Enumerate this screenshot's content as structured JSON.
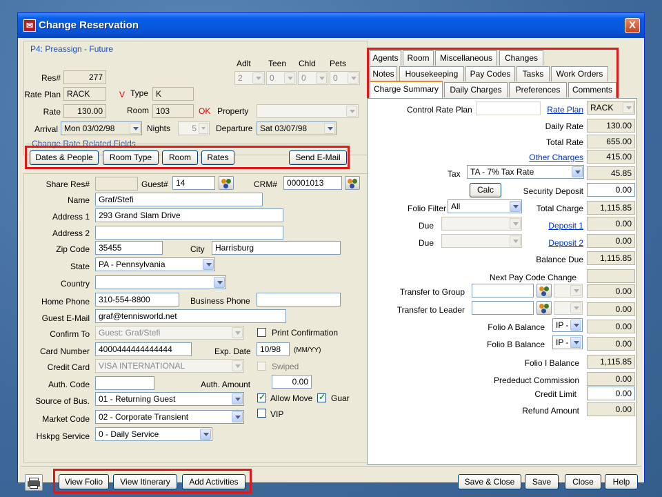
{
  "window": {
    "title": "Change Reservation",
    "close_label": "X"
  },
  "status": {
    "text": "P4: Preassign - Future"
  },
  "res": {
    "res_label": "Res#",
    "res_value": "277",
    "rate_plan_label": "Rate Plan",
    "rate_plan_value": "RACK",
    "v_marker": "V",
    "type_label": "Type",
    "type_value": "K",
    "rate_label": "Rate",
    "rate_value": "130.00",
    "room_label": "Room",
    "room_value": "103",
    "ok_marker": "OK",
    "property_label": "Property",
    "property_value": "",
    "arrival_label": "Arrival",
    "arrival_value": "Mon 03/02/98",
    "nights_label": "Nights",
    "nights_value": "5",
    "departure_label": "Departure",
    "departure_value": "Sat 03/07/98",
    "adlt_label": "Adlt",
    "teen_label": "Teen",
    "chld_label": "Chld",
    "pets_label": "Pets",
    "adlt_value": "2",
    "teen_value": "0",
    "chld_value": "0",
    "pets_value": "0",
    "group_caption": "Change Rate Related Fields"
  },
  "rate_buttons": {
    "dates_people": "Dates & People",
    "room_type": "Room Type",
    "room": "Room",
    "rates": "Rates",
    "send_email": "Send E-Mail"
  },
  "guest": {
    "share_res_label": "Share Res#",
    "share_res_value": "",
    "guest_no_label": "Guest#",
    "guest_no_value": "14",
    "crm_label": "CRM#",
    "crm_value": "00001013",
    "name_label": "Name",
    "name_value": "Graf/Stefi",
    "address1_label": "Address 1",
    "address1_value": "293 Grand Slam Drive",
    "address2_label": "Address 2",
    "address2_value": "",
    "zip_label": "Zip Code",
    "zip_value": "35455",
    "city_label": "City",
    "city_value": "Harrisburg",
    "state_label": "State",
    "state_value": "PA - Pennsylvania",
    "country_label": "Country",
    "country_value": "",
    "home_phone_label": "Home Phone",
    "home_phone_value": "310-554-8800",
    "business_phone_label": "Business Phone",
    "business_phone_value": "",
    "email_label": "Guest E-Mail",
    "email_value": "graf@tennisworld.net",
    "confirm_to_label": "Confirm To",
    "confirm_to_value": "Guest: Graf/Stefi",
    "print_confirmation_label": "Print Confirmation",
    "card_number_label": "Card Number",
    "card_number_value": "4000444444444444",
    "exp_date_label": "Exp. Date",
    "exp_date_value": "10/98",
    "exp_date_hint": "(MM/YY)",
    "credit_card_label": "Credit Card",
    "credit_card_value": "VISA INTERNATIONAL",
    "swiped_label": "Swiped",
    "auth_code_label": "Auth. Code",
    "auth_code_value": "",
    "auth_amount_label": "Auth. Amount",
    "auth_amount_value": "0.00",
    "source_label": "Source of Bus.",
    "source_value": "01 - Returning Guest",
    "allow_move_label": "Allow Move",
    "guar_label": "Guar",
    "market_label": "Market Code",
    "market_value": "02 - Corporate Transient",
    "vip_label": "VIP",
    "hskpg_label": "Hskpg Service",
    "hskpg_value": "0 - Daily Service"
  },
  "tabs": {
    "row1": [
      "Agents",
      "Room",
      "Miscellaneous",
      "Changes"
    ],
    "row2": [
      "Notes",
      "Housekeeping",
      "Pay Codes",
      "Tasks",
      "Work Orders"
    ],
    "row3": [
      "Charge Summary",
      "Daily Charges",
      "Preferences",
      "Comments"
    ]
  },
  "charges": {
    "control_rate_plan_label": "Control Rate Plan",
    "rate_plan_link": "Rate Plan",
    "rate_plan_value": "RACK",
    "daily_rate_label": "Daily Rate",
    "daily_rate_value": "130.00",
    "total_rate_label": "Total Rate",
    "total_rate_value": "655.00",
    "other_charges_link": "Other Charges",
    "other_charges_value": "415.00",
    "tax_label": "Tax",
    "tax_select": "TA - 7% Tax Rate",
    "tax_value": "45.85",
    "calc_button": "Calc",
    "security_deposit_label": "Security Deposit",
    "security_deposit_value": "0.00",
    "folio_filter_label": "Folio Filter",
    "folio_filter_value": "All",
    "total_charge_label": "Total Charge",
    "total_charge_value": "1,115.85",
    "due_label": "Due",
    "deposit1_link": "Deposit 1",
    "deposit1_value": "0.00",
    "deposit2_link": "Deposit 2",
    "deposit2_value": "0.00",
    "balance_due_label": "Balance Due",
    "balance_due_value": "1,115.85",
    "next_pay_code_label": "Next Pay Code Change",
    "transfer_group_label": "Transfer to Group",
    "transfer_group_value": "0.00",
    "transfer_leader_label": "Transfer to Leader",
    "transfer_leader_value": "0.00",
    "folio_a_label": "Folio A Balance",
    "folio_a_code": "IP -",
    "folio_a_value": "0.00",
    "folio_b_label": "Folio B Balance",
    "folio_b_code": "IP -",
    "folio_b_value": "0.00",
    "folio_i_label": "Folio I Balance",
    "folio_i_value": "1,115.85",
    "prededuct_label": "Prededuct Commission",
    "prededuct_value": "0.00",
    "credit_limit_label": "Credit Limit",
    "credit_limit_value": "0.00",
    "refund_label": "Refund Amount",
    "refund_value": "0.00"
  },
  "footer": {
    "view_folio": "View Folio",
    "view_itinerary": "View Itinerary",
    "add_activities": "Add Activities",
    "save_close": "Save & Close",
    "save": "Save",
    "close": "Close",
    "help": "Help"
  },
  "colors": {
    "highlight": "#e01818",
    "title_bar": "#0755d9",
    "status_text": "#1f4fb0"
  }
}
